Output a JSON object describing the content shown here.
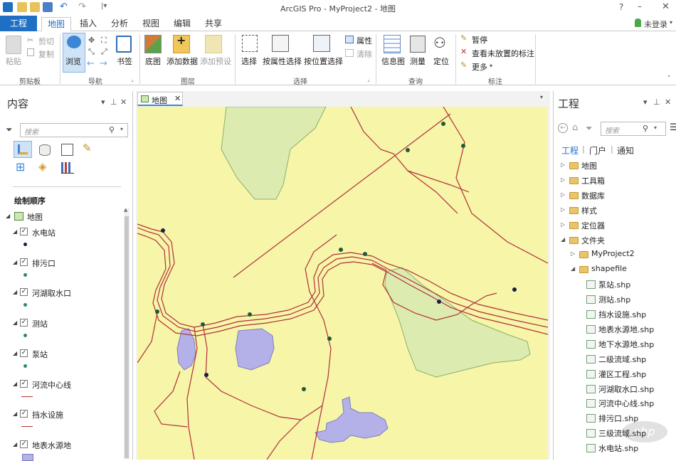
{
  "window": {
    "title": "ArcGIS Pro - MyProject2 - 地图",
    "help": "?",
    "login": "未登录"
  },
  "tabs": [
    "工程",
    "地图",
    "插入",
    "分析",
    "视图",
    "编辑",
    "共享"
  ],
  "ribbon": {
    "clipboard": {
      "paste": "粘贴",
      "cut": "剪切",
      "copy": "复制",
      "label": "剪贴板"
    },
    "navigate": {
      "explore": "浏览",
      "bookmarks": "书签",
      "label": "导航"
    },
    "layer": {
      "basemap": "底图",
      "add_data": "添加数据",
      "add_preset": "添加预设",
      "label": "图层"
    },
    "selection": {
      "select": "选择",
      "by_attributes": "按属性选择",
      "by_location": "按位置选择",
      "attributes": "属性",
      "clear": "清除",
      "label": "选择"
    },
    "inquiry": {
      "infographics": "信息图",
      "measure": "测量",
      "locate": "定位",
      "label": "查询"
    },
    "labeling": {
      "pause": "暂停",
      "view_unplaced": "查看未放置的标注",
      "more": "更多",
      "label": "标注"
    }
  },
  "contents": {
    "title": "内容",
    "search_placeholder": "搜索",
    "section": "绘制顺序",
    "map_name": "地图",
    "layers": [
      {
        "name": "水电站",
        "symbol": "#1c1c4a",
        "type": "point"
      },
      {
        "name": "排污口",
        "symbol": "#2e8b57",
        "type": "point"
      },
      {
        "name": "河湖取水口",
        "symbol": "#2e8b57",
        "type": "point"
      },
      {
        "name": "测站",
        "symbol": "#2e8b57",
        "type": "point"
      },
      {
        "name": "泵站",
        "symbol": "#2e8b57",
        "type": "point"
      },
      {
        "name": "河流中心线",
        "symbol": "#b03030",
        "type": "line"
      },
      {
        "name": "挡水设施",
        "symbol": "#b03030",
        "type": "line"
      },
      {
        "name": "地表水源地",
        "symbol": "#b3b3e6",
        "type": "polygon"
      }
    ]
  },
  "map_view": {
    "tab_label": "地图",
    "background": "#f7f5a8",
    "water_fill": "#b4b0e8",
    "green_fill": "#dcebb0",
    "river_color": "#b0303a"
  },
  "catalog": {
    "title": "工程",
    "search_placeholder": "搜索",
    "tabs": [
      "工程",
      "门户",
      "通知"
    ],
    "tree": [
      {
        "label": "地图",
        "level": 0,
        "kind": "map"
      },
      {
        "label": "工具箱",
        "level": 0,
        "kind": "toolbox"
      },
      {
        "label": "数据库",
        "level": 0,
        "kind": "db"
      },
      {
        "label": "样式",
        "level": 0,
        "kind": "style"
      },
      {
        "label": "定位器",
        "level": 0,
        "kind": "locator"
      },
      {
        "label": "文件夹",
        "level": 0,
        "kind": "folder"
      },
      {
        "label": "MyProject2",
        "level": 1,
        "kind": "folder"
      },
      {
        "label": "shapefile",
        "level": 1,
        "kind": "folder"
      },
      {
        "label": "泵站.shp",
        "level": 2,
        "kind": "point"
      },
      {
        "label": "测站.shp",
        "level": 2,
        "kind": "point"
      },
      {
        "label": "挡水设施.shp",
        "level": 2,
        "kind": "line"
      },
      {
        "label": "地表水源地.shp",
        "level": 2,
        "kind": "polygon"
      },
      {
        "label": "地下水源地.shp",
        "level": 2,
        "kind": "polygon"
      },
      {
        "label": "二级流域.shp",
        "level": 2,
        "kind": "polygon"
      },
      {
        "label": "灌区工程.shp",
        "level": 2,
        "kind": "polygon"
      },
      {
        "label": "河湖取水口.shp",
        "level": 2,
        "kind": "point"
      },
      {
        "label": "河流中心线.shp",
        "level": 2,
        "kind": "line"
      },
      {
        "label": "排污口.shp",
        "level": 2,
        "kind": "point"
      },
      {
        "label": "三级流域.shp",
        "level": 2,
        "kind": "polygon"
      },
      {
        "label": "水电站.shp",
        "level": 2,
        "kind": "point"
      }
    ]
  },
  "watermark": "php"
}
